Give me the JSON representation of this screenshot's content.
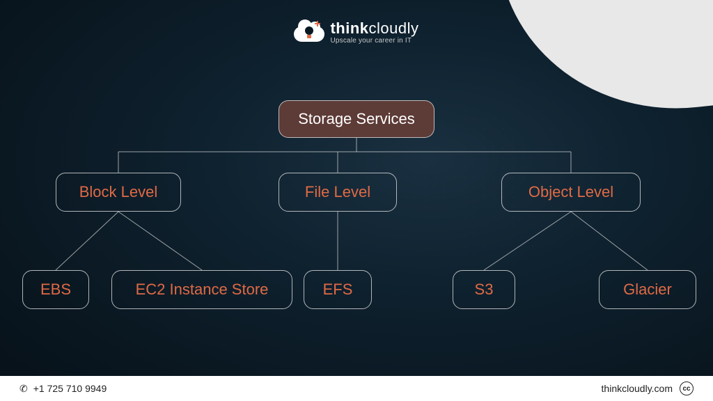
{
  "brand": {
    "name_bold": "think",
    "name_light": "cloudly",
    "tagline": "Upscale your career in IT"
  },
  "diagram": {
    "root": "Storage Services",
    "categories": [
      {
        "label": "Block Level",
        "children": [
          "EBS",
          "EC2 Instance Store"
        ]
      },
      {
        "label": "File Level",
        "children": [
          "EFS"
        ]
      },
      {
        "label": "Object Level",
        "children": [
          "S3",
          "Glacier"
        ]
      }
    ]
  },
  "footer": {
    "phone": "+1 725 710 9949",
    "website": "thinkcloudly.com",
    "license": "cc"
  },
  "colors": {
    "accent": "#e06a45",
    "root_bg": "#5d3b37",
    "bg_dark": "#0a1822"
  }
}
